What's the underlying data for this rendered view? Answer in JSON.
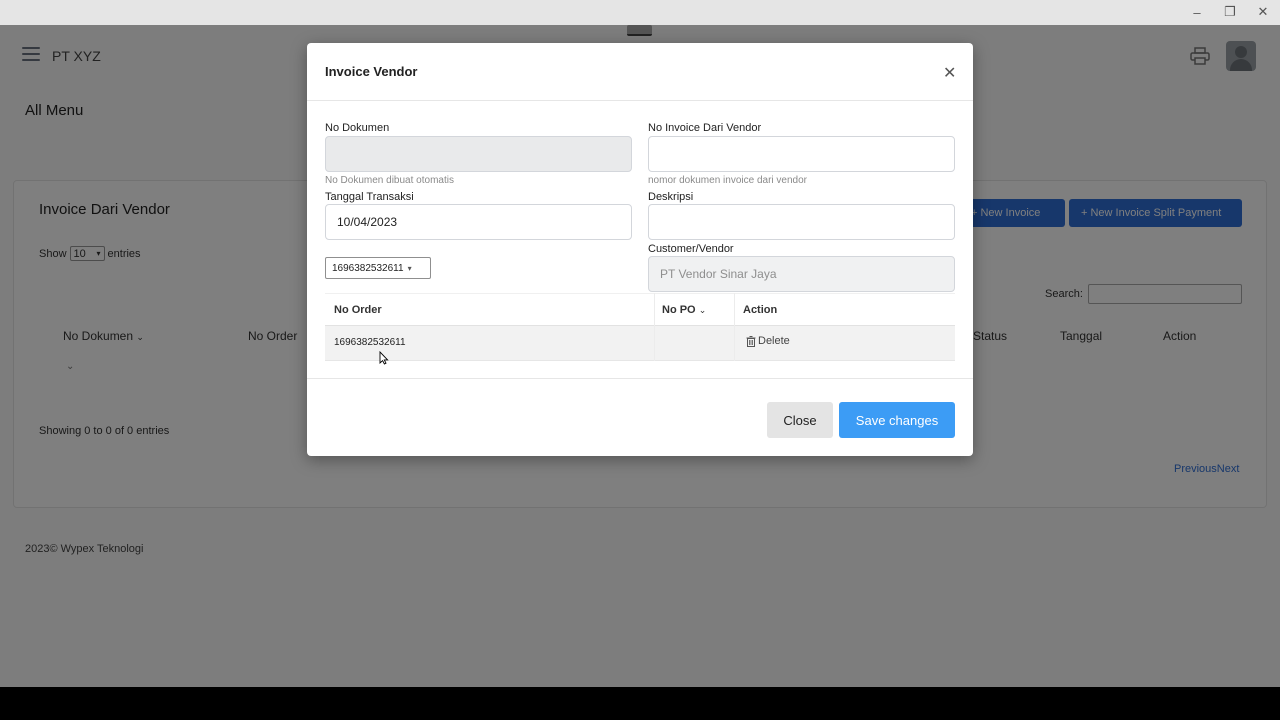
{
  "window": {
    "minimize_glyph": "–",
    "maximize_glyph": "❐",
    "close_glyph": "✕"
  },
  "navbar": {
    "brand": "PT XYZ",
    "menu_icon": "hamburger-icon",
    "print_icon": "printer-icon",
    "avatar_icon": "user-avatar-icon"
  },
  "page": {
    "heading": "All Menu"
  },
  "card": {
    "title": "Invoice Dari Vendor",
    "new_invoice_label": "+ New Invoice",
    "new_split_label": "+ New Invoice Split Payment",
    "show_label": "Show",
    "entries_value": "10",
    "entries_label": "entries",
    "search_label": "Search:",
    "columns": [
      "No Dokumen",
      "No Order",
      "Status",
      "Tanggal",
      "Action"
    ],
    "showing_text": "Showing 0 to 0 of 0 entries",
    "prev_label": "Previous",
    "next_label": "Next"
  },
  "footer": {
    "text": "2023© Wypex Teknologi"
  },
  "modal": {
    "title": "Invoice Vendor",
    "close_icon": "close-icon",
    "no_dokumen": {
      "label": "No Dokumen",
      "value": "",
      "hint": "No Dokumen dibuat otomatis"
    },
    "no_invoice": {
      "label": "No Invoice Dari Vendor",
      "value": "",
      "hint": "nomor dokumen invoice dari vendor"
    },
    "tanggal": {
      "label": "Tanggal Transaksi",
      "value": "10/04/2023"
    },
    "deskripsi": {
      "label": "Deskripsi",
      "value": ""
    },
    "customer": {
      "label": "Customer/Vendor",
      "value": "PT Vendor Sinar Jaya"
    },
    "order_select": {
      "selected": "1696382532611",
      "caret": "▾"
    },
    "table": {
      "headers": {
        "no_order": "No Order",
        "no_po": "No PO",
        "action": "Action"
      },
      "rows": [
        {
          "no_order": "1696382532611",
          "no_po": "",
          "action": "Delete"
        }
      ]
    },
    "close_button": "Close",
    "save_button": "Save changes"
  }
}
